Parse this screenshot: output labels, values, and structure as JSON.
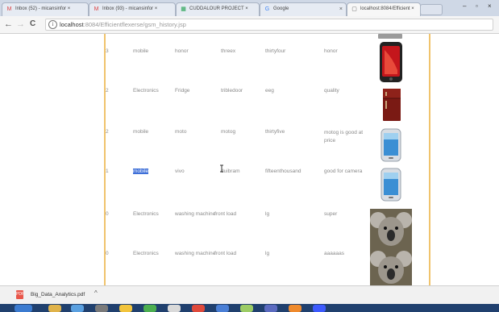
{
  "tabs": [
    {
      "icon": "gmail-icon",
      "glyph": "M",
      "label": "Inbox (52) - micansinfor ×",
      "active": false
    },
    {
      "icon": "gmail-icon",
      "glyph": "M",
      "label": "Inbox (93) - micansinfor ×",
      "active": false
    },
    {
      "icon": "sheets-icon",
      "glyph": "▦",
      "label": "CUDDALOUR PROJECT ×",
      "active": false
    },
    {
      "icon": "google-icon",
      "glyph": "G",
      "label": "Google",
      "active": false
    },
    {
      "icon": "page-icon",
      "glyph": "▢",
      "label": "localhost:8084/Efficient ×",
      "active": true
    }
  ],
  "toolbar": {
    "back": "←",
    "forward": "→",
    "reload": "C",
    "info": "i",
    "url_host": "localhost",
    "url_path": ":8084/Efficientflexerse/gsm_history.jsp"
  },
  "table": {
    "rows": [
      {
        "num": "3",
        "category": "mobile",
        "brand": "honor",
        "model": "threex",
        "price": "thirtyfour",
        "review": "honor",
        "image": "phone-red"
      },
      {
        "num": "2",
        "category": "Electronics",
        "brand": "Fridge",
        "model": "tribledoor",
        "price": "eeg",
        "review": "quality",
        "image": "fridge"
      },
      {
        "num": "2",
        "category": "mobile",
        "brand": "moto",
        "model": "motog",
        "price": "thirtyfive",
        "review": "motog is good at price",
        "image": "phone-white"
      },
      {
        "num": "1",
        "category": "mobile",
        "brand": "vivo",
        "model": "duibram",
        "price": "fifteenthousand",
        "review": "good for camera",
        "image": "phone-white"
      },
      {
        "num": "0",
        "category": "Electronics",
        "brand": "washing machine",
        "model": "front load",
        "price": "lg",
        "review": "super",
        "image": "koala"
      },
      {
        "num": "0",
        "category": "Electronics",
        "brand": "washing machine",
        "model": "front load",
        "price": "lg",
        "review": "aaaaaas",
        "image": "koala"
      }
    ]
  },
  "downloads": {
    "file": "Big_Data_Analytics.pdf",
    "menu": "^"
  },
  "colors": {
    "accent_rule": "#f0c36c",
    "highlight": "#3e6fd8"
  }
}
